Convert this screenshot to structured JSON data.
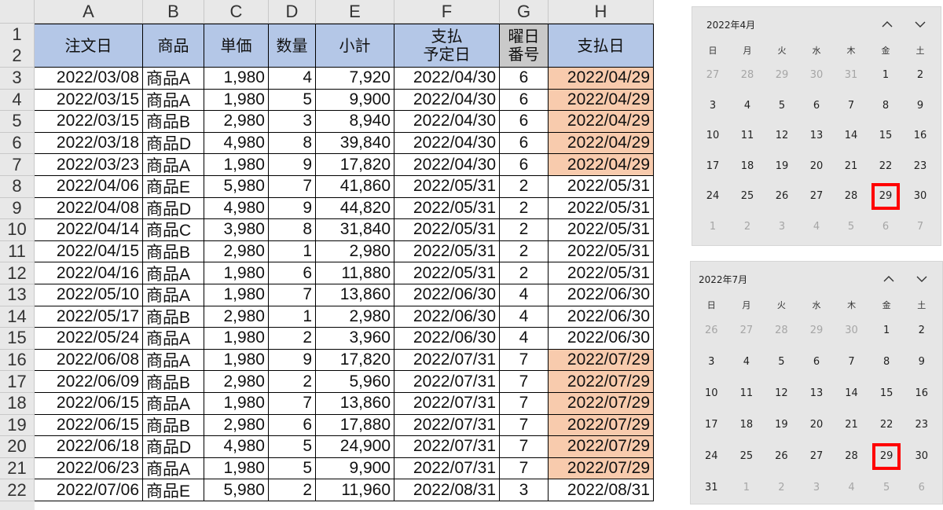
{
  "sheet": {
    "column_headers": [
      "A",
      "B",
      "C",
      "D",
      "E",
      "F",
      "G",
      "H"
    ],
    "row_header_dual": [
      "1",
      "2"
    ],
    "table_headers": [
      [
        "注文日"
      ],
      [
        "商品"
      ],
      [
        "単価"
      ],
      [
        "数量"
      ],
      [
        "小計"
      ],
      [
        "支払",
        "予定日"
      ],
      [
        "曜日",
        "番号"
      ],
      [
        "支払日"
      ]
    ],
    "rows": [
      {
        "n": "3",
        "order": "2022/03/08",
        "item": "商品A",
        "price": "1,980",
        "qty": "4",
        "subtotal": "7,920",
        "due": "2022/04/30",
        "dow": "6",
        "paid": "2022/04/29",
        "hl": true
      },
      {
        "n": "4",
        "order": "2022/03/15",
        "item": "商品A",
        "price": "1,980",
        "qty": "5",
        "subtotal": "9,900",
        "due": "2022/04/30",
        "dow": "6",
        "paid": "2022/04/29",
        "hl": true
      },
      {
        "n": "5",
        "order": "2022/03/15",
        "item": "商品B",
        "price": "2,980",
        "qty": "3",
        "subtotal": "8,940",
        "due": "2022/04/30",
        "dow": "6",
        "paid": "2022/04/29",
        "hl": true
      },
      {
        "n": "6",
        "order": "2022/03/18",
        "item": "商品D",
        "price": "4,980",
        "qty": "8",
        "subtotal": "39,840",
        "due": "2022/04/30",
        "dow": "6",
        "paid": "2022/04/29",
        "hl": true
      },
      {
        "n": "7",
        "order": "2022/03/23",
        "item": "商品A",
        "price": "1,980",
        "qty": "9",
        "subtotal": "17,820",
        "due": "2022/04/30",
        "dow": "6",
        "paid": "2022/04/29",
        "hl": true
      },
      {
        "n": "8",
        "order": "2022/04/06",
        "item": "商品E",
        "price": "5,980",
        "qty": "7",
        "subtotal": "41,860",
        "due": "2022/05/31",
        "dow": "2",
        "paid": "2022/05/31",
        "hl": false
      },
      {
        "n": "9",
        "order": "2022/04/08",
        "item": "商品D",
        "price": "4,980",
        "qty": "9",
        "subtotal": "44,820",
        "due": "2022/05/31",
        "dow": "2",
        "paid": "2022/05/31",
        "hl": false
      },
      {
        "n": "10",
        "order": "2022/04/14",
        "item": "商品C",
        "price": "3,980",
        "qty": "8",
        "subtotal": "31,840",
        "due": "2022/05/31",
        "dow": "2",
        "paid": "2022/05/31",
        "hl": false
      },
      {
        "n": "11",
        "order": "2022/04/15",
        "item": "商品B",
        "price": "2,980",
        "qty": "1",
        "subtotal": "2,980",
        "due": "2022/05/31",
        "dow": "2",
        "paid": "2022/05/31",
        "hl": false
      },
      {
        "n": "12",
        "order": "2022/04/16",
        "item": "商品A",
        "price": "1,980",
        "qty": "6",
        "subtotal": "11,880",
        "due": "2022/05/31",
        "dow": "2",
        "paid": "2022/05/31",
        "hl": false
      },
      {
        "n": "13",
        "order": "2022/05/10",
        "item": "商品A",
        "price": "1,980",
        "qty": "7",
        "subtotal": "13,860",
        "due": "2022/06/30",
        "dow": "4",
        "paid": "2022/06/30",
        "hl": false
      },
      {
        "n": "14",
        "order": "2022/05/17",
        "item": "商品B",
        "price": "2,980",
        "qty": "1",
        "subtotal": "2,980",
        "due": "2022/06/30",
        "dow": "4",
        "paid": "2022/06/30",
        "hl": false
      },
      {
        "n": "15",
        "order": "2022/05/24",
        "item": "商品A",
        "price": "1,980",
        "qty": "2",
        "subtotal": "3,960",
        "due": "2022/06/30",
        "dow": "4",
        "paid": "2022/06/30",
        "hl": false
      },
      {
        "n": "16",
        "order": "2022/06/08",
        "item": "商品A",
        "price": "1,980",
        "qty": "9",
        "subtotal": "17,820",
        "due": "2022/07/31",
        "dow": "7",
        "paid": "2022/07/29",
        "hl": true
      },
      {
        "n": "17",
        "order": "2022/06/09",
        "item": "商品B",
        "price": "2,980",
        "qty": "2",
        "subtotal": "5,960",
        "due": "2022/07/31",
        "dow": "7",
        "paid": "2022/07/29",
        "hl": true
      },
      {
        "n": "18",
        "order": "2022/06/15",
        "item": "商品A",
        "price": "1,980",
        "qty": "7",
        "subtotal": "13,860",
        "due": "2022/07/31",
        "dow": "7",
        "paid": "2022/07/29",
        "hl": true
      },
      {
        "n": "19",
        "order": "2022/06/15",
        "item": "商品B",
        "price": "2,980",
        "qty": "6",
        "subtotal": "17,880",
        "due": "2022/07/31",
        "dow": "7",
        "paid": "2022/07/29",
        "hl": true
      },
      {
        "n": "20",
        "order": "2022/06/18",
        "item": "商品D",
        "price": "4,980",
        "qty": "5",
        "subtotal": "24,900",
        "due": "2022/07/31",
        "dow": "7",
        "paid": "2022/07/29",
        "hl": true
      },
      {
        "n": "21",
        "order": "2022/06/23",
        "item": "商品A",
        "price": "1,980",
        "qty": "5",
        "subtotal": "9,900",
        "due": "2022/07/31",
        "dow": "7",
        "paid": "2022/07/29",
        "hl": true
      },
      {
        "n": "22",
        "order": "2022/07/06",
        "item": "商品E",
        "price": "5,980",
        "qty": "2",
        "subtotal": "11,960",
        "due": "2022/08/31",
        "dow": "3",
        "paid": "2022/08/31",
        "hl": false
      }
    ],
    "colors": {
      "header_fill": "#b4c7e7",
      "highlight_fill": "#f8cbad",
      "dow_header_fill": "#c9c9c9"
    }
  },
  "calendars": [
    {
      "month_label": "2022年4月",
      "weekdays": [
        "日",
        "月",
        "火",
        "水",
        "木",
        "金",
        "土"
      ],
      "days": [
        {
          "d": "27",
          "dim": true
        },
        {
          "d": "28",
          "dim": true
        },
        {
          "d": "29",
          "dim": true
        },
        {
          "d": "30",
          "dim": true
        },
        {
          "d": "31",
          "dim": true
        },
        {
          "d": "1"
        },
        {
          "d": "2"
        },
        {
          "d": "3"
        },
        {
          "d": "4"
        },
        {
          "d": "5"
        },
        {
          "d": "6"
        },
        {
          "d": "7"
        },
        {
          "d": "8"
        },
        {
          "d": "9"
        },
        {
          "d": "10"
        },
        {
          "d": "11"
        },
        {
          "d": "12"
        },
        {
          "d": "13"
        },
        {
          "d": "14"
        },
        {
          "d": "15"
        },
        {
          "d": "16"
        },
        {
          "d": "17"
        },
        {
          "d": "18"
        },
        {
          "d": "19"
        },
        {
          "d": "20"
        },
        {
          "d": "21"
        },
        {
          "d": "22"
        },
        {
          "d": "23"
        },
        {
          "d": "24"
        },
        {
          "d": "25"
        },
        {
          "d": "26"
        },
        {
          "d": "27"
        },
        {
          "d": "28"
        },
        {
          "d": "29",
          "sel": true
        },
        {
          "d": "30"
        },
        {
          "d": "1",
          "dim": true
        },
        {
          "d": "2",
          "dim": true
        },
        {
          "d": "3",
          "dim": true
        },
        {
          "d": "4",
          "dim": true
        },
        {
          "d": "5",
          "dim": true
        },
        {
          "d": "6",
          "dim": true
        },
        {
          "d": "7",
          "dim": true
        }
      ],
      "nav": {
        "up_icon": "chevron-up-icon",
        "down_icon": "chevron-down-icon"
      }
    },
    {
      "month_label": "2022年7月",
      "weekdays": [
        "日",
        "月",
        "火",
        "水",
        "木",
        "金",
        "土"
      ],
      "days": [
        {
          "d": "26",
          "dim": true
        },
        {
          "d": "27",
          "dim": true
        },
        {
          "d": "28",
          "dim": true
        },
        {
          "d": "29",
          "dim": true
        },
        {
          "d": "30",
          "dim": true
        },
        {
          "d": "1"
        },
        {
          "d": "2"
        },
        {
          "d": "3"
        },
        {
          "d": "4"
        },
        {
          "d": "5"
        },
        {
          "d": "6"
        },
        {
          "d": "7"
        },
        {
          "d": "8"
        },
        {
          "d": "9"
        },
        {
          "d": "10"
        },
        {
          "d": "11"
        },
        {
          "d": "12"
        },
        {
          "d": "13"
        },
        {
          "d": "14"
        },
        {
          "d": "15"
        },
        {
          "d": "16"
        },
        {
          "d": "17"
        },
        {
          "d": "18"
        },
        {
          "d": "19"
        },
        {
          "d": "20"
        },
        {
          "d": "21"
        },
        {
          "d": "22"
        },
        {
          "d": "23"
        },
        {
          "d": "24"
        },
        {
          "d": "25"
        },
        {
          "d": "26"
        },
        {
          "d": "27"
        },
        {
          "d": "28"
        },
        {
          "d": "29",
          "sel": true
        },
        {
          "d": "30"
        },
        {
          "d": "31"
        },
        {
          "d": "1",
          "dim": true
        },
        {
          "d": "2",
          "dim": true
        },
        {
          "d": "3",
          "dim": true
        },
        {
          "d": "4",
          "dim": true
        },
        {
          "d": "5",
          "dim": true
        },
        {
          "d": "6",
          "dim": true
        }
      ],
      "nav": {
        "up_icon": "chevron-up-icon",
        "down_icon": "chevron-down-icon"
      }
    }
  ],
  "selection_color": "#ff0000"
}
